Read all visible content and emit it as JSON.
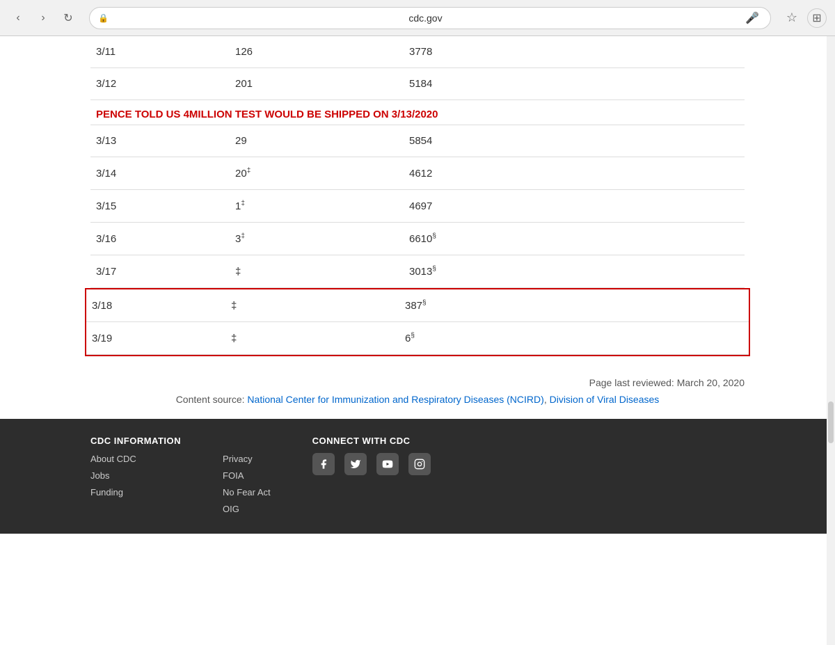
{
  "browser": {
    "url": "cdc.gov",
    "nav": {
      "back": "‹",
      "forward": "›",
      "reload": "↻"
    }
  },
  "table": {
    "rows": [
      {
        "date": "3/11",
        "new_tests": "126",
        "cumulative": "3778",
        "highlight": false,
        "new_super": "",
        "cum_super": ""
      },
      {
        "date": "3/12",
        "new_tests": "201",
        "cumulative": "5184",
        "highlight": false,
        "new_super": "",
        "cum_super": ""
      },
      {
        "date": "3/13",
        "new_tests": "29",
        "cumulative": "5854",
        "highlight": false,
        "new_super": "",
        "cum_super": ""
      },
      {
        "date": "3/14",
        "new_tests": "20",
        "cumulative": "4612",
        "highlight": false,
        "new_super": "‡",
        "cum_super": ""
      },
      {
        "date": "3/15",
        "new_tests": "1",
        "cumulative": "4697",
        "highlight": false,
        "new_super": "‡",
        "cum_super": ""
      },
      {
        "date": "3/16",
        "new_tests": "3",
        "cumulative": "6610",
        "highlight": false,
        "new_super": "‡",
        "cum_super": "§"
      },
      {
        "date": "3/17",
        "new_tests": "‡",
        "cumulative": "3013",
        "highlight": false,
        "new_super": "",
        "cum_super": "§"
      },
      {
        "date": "3/18",
        "new_tests": "‡",
        "cumulative": "387",
        "highlight": true,
        "new_super": "",
        "cum_super": "§"
      },
      {
        "date": "3/19",
        "new_tests": "‡",
        "cumulative": "6",
        "highlight": true,
        "new_super": "",
        "cum_super": "§"
      }
    ],
    "pence_annotation": "PENCE TOLD US 4MILLION TEST WOULD BE SHIPPED ON 3/13/2020"
  },
  "meta": {
    "page_last_reviewed": "Page last reviewed: March 20, 2020",
    "content_source_label": "Content source: ",
    "content_source_link1": "National Center for Immunization and Respiratory Diseases (NCIRD)",
    "content_source_sep": ", ",
    "content_source_link2": "Division of Viral Diseases"
  },
  "footer": {
    "cdc_info": {
      "heading": "CDC INFORMATION",
      "links": [
        "About CDC",
        "Jobs",
        "Funding"
      ]
    },
    "policies": {
      "heading": "",
      "links": [
        "Privacy",
        "FOIA",
        "No Fear Act",
        "OIG"
      ]
    },
    "connect": {
      "heading": "CONNECT WITH CDC",
      "socials": [
        "facebook",
        "twitter",
        "youtube",
        "instagram"
      ]
    }
  }
}
